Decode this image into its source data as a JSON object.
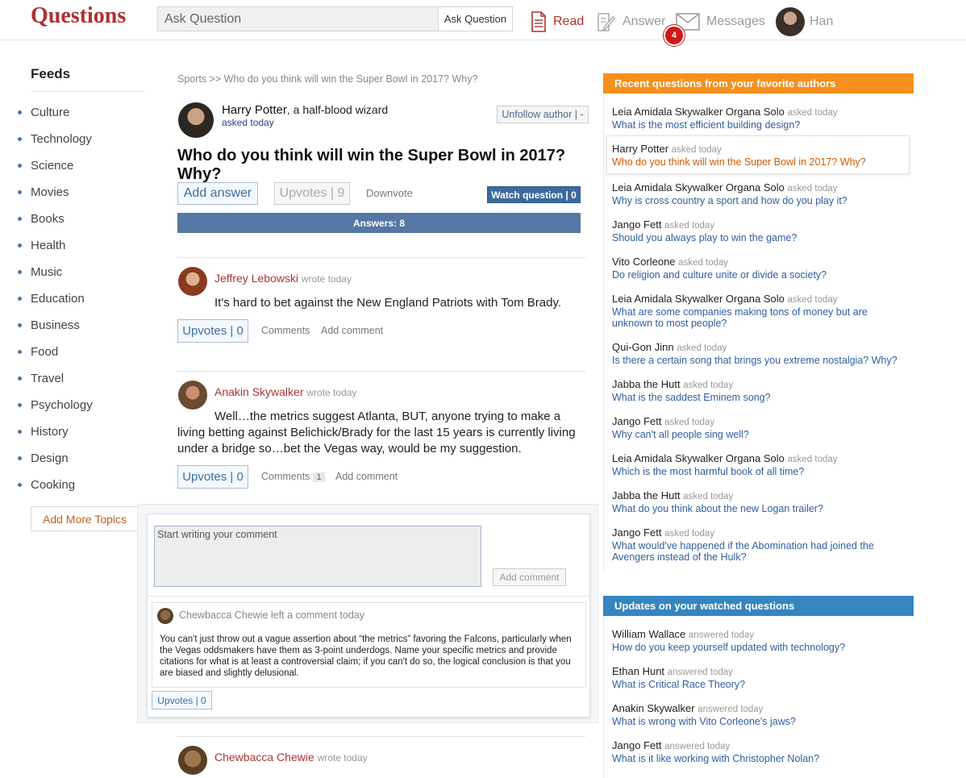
{
  "app": {
    "logo": "Questions"
  },
  "search": {
    "placeholder": "Ask Question",
    "button_label": "Ask Question"
  },
  "nav": {
    "read": "Read",
    "answer": "Answer",
    "messages": "Messages",
    "messages_badge": "4",
    "user": "Han"
  },
  "sidebar": {
    "title": "Feeds",
    "items": [
      "Culture",
      "Technology",
      "Science",
      "Movies",
      "Books",
      "Health",
      "Music",
      "Education",
      "Business",
      "Food",
      "Travel",
      "Psychology",
      "History",
      "Design",
      "Cooking"
    ],
    "add_more": "Add More Topics"
  },
  "question": {
    "breadcrumb": "Sports >> Who do you think will win the Super Bowl in 2017? Why?",
    "author_name": "Harry Potter",
    "author_tagline": ", a half-blood wizard",
    "asked": "asked today",
    "unfollow": "Unfollow author | -",
    "title": "Who do you think will win the Super Bowl in 2017? Why?",
    "add_answer": "Add answer",
    "upvotes": "Upvotes | 9",
    "downvote": "Downvote",
    "watch": "Watch question | 0",
    "answers_count": "Answers: 8"
  },
  "answers": [
    {
      "author": "Jeffrey Lebowski",
      "wrote": "wrote today",
      "text": "It's hard to bet against the New England Patriots with Tom Brady.",
      "upvotes": "Upvotes | 0",
      "comments": "Comments",
      "add_comment": "Add comment"
    },
    {
      "author": "Anakin Skywalker",
      "wrote": "wrote today",
      "text": "Well…the metrics suggest Atlanta, BUT, anyone trying to make a living betting against Belichick/Brady for the last 15 years is currently living under a bridge so…bet the Vegas way, would be my suggestion.",
      "upvotes": "Upvotes | 0",
      "comments": "Comments",
      "comments_count": "1",
      "add_comment": "Add comment"
    },
    {
      "author": "Chewbacca Chewie",
      "wrote": "wrote today"
    }
  ],
  "comment_box": {
    "placeholder": "Start writing your comment",
    "button": "Add comment",
    "comment": {
      "header": "Chewbacca Chewie left a comment today",
      "text": "You can't just throw out a vague assertion about “the metrics” favoring the Falcons, particularly when the Vegas oddsmakers have them as 3-point underdogs. Name your specific metrics and provide citations for what is at least a controversial claim; if you can't do so, the logical conclusion is that you are biased and slightly delusional.",
      "upvotes": "Upvotes | 0"
    }
  },
  "recent": {
    "title": "Recent questions from your favorite authors",
    "items": [
      {
        "author": "Leia Amidala Skywalker Organa Solo",
        "when": "asked today",
        "question": "What is the most efficient building design?"
      },
      {
        "author": "Harry Potter",
        "when": "asked today",
        "question": "Who do you think will win the Super Bowl in 2017? Why?"
      },
      {
        "author": "Leia Amidala Skywalker Organa Solo",
        "when": "asked today",
        "question": "Why is cross country a sport and how do you play it?"
      },
      {
        "author": "Jango Fett",
        "when": "asked today",
        "question": "Should you always play to win the game?"
      },
      {
        "author": "Vito Corleone",
        "when": "asked today",
        "question": "Do religion and culture unite or divide a society?"
      },
      {
        "author": "Leia Amidala Skywalker Organa Solo",
        "when": "asked today",
        "question": "What are some companies making tons of money but are unknown to most people?"
      },
      {
        "author": "Qui-Gon Jinn",
        "when": "asked today",
        "question": "Is there a certain song that brings you extreme nostalgia? Why?"
      },
      {
        "author": "Jabba the Hutt",
        "when": "asked today",
        "question": "What is the saddest Eminem song?"
      },
      {
        "author": "Jango Fett",
        "when": "asked today",
        "question": "Why can't all people sing well?"
      },
      {
        "author": "Leia Amidala Skywalker Organa Solo",
        "when": "asked today",
        "question": "Which is the most harmful book of all time?"
      },
      {
        "author": "Jabba the Hutt",
        "when": "asked today",
        "question": "What do you think about the new Logan trailer?"
      },
      {
        "author": "Jango Fett",
        "when": "asked today",
        "question": "What would've happened if the Abomination had joined the Avengers instead of the Hulk?"
      }
    ]
  },
  "updates": {
    "title": "Updates on your watched questions",
    "items": [
      {
        "author": "William Wallace",
        "when": "answered today",
        "question": "How do you keep yourself updated with technology?"
      },
      {
        "author": "Ethan Hunt",
        "when": "answered today",
        "question": "What is Critical Race Theory?"
      },
      {
        "author": "Anakin Skywalker",
        "when": "answered today",
        "question": "What is wrong with Vito Corleone's jaws?"
      },
      {
        "author": "Jango Fett",
        "when": "answered today",
        "question": "What is it like working with Christopher Nolan?"
      }
    ]
  },
  "colors": {
    "brand_red": "#b22f2f",
    "link_blue": "#2f5ea0",
    "orange_header": "#f7901e",
    "blue_header": "#3585c0",
    "answers_bar": "#5577a3"
  }
}
